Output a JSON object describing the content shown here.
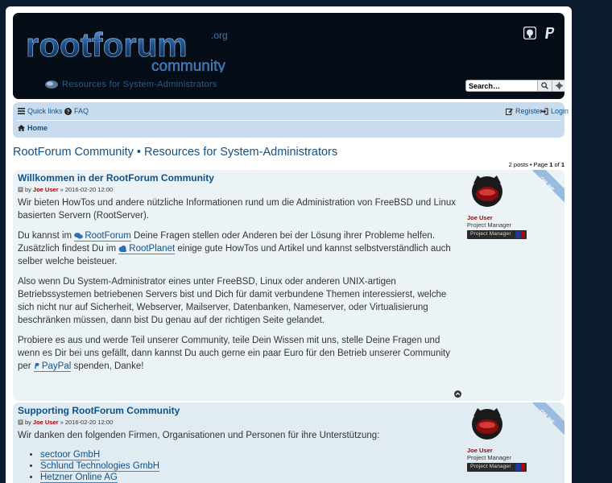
{
  "header": {
    "logo_text": "rootforum",
    "logo_org": ".org",
    "logo_sub": "community",
    "tagline": "Resources for System-Administrators",
    "search_placeholder": "Search…",
    "search_icon": "search-icon",
    "advanced_icon": "gear-icon",
    "social": [
      "github-icon",
      "paypal-icon"
    ]
  },
  "navbar": {
    "quick_links": "Quick links",
    "faq": "FAQ",
    "register": "Register",
    "login": "Login",
    "home": "Home"
  },
  "forum_title": "RootForum Community • Resources for System-Administrators",
  "pagination": {
    "prefix": "2 posts • Page ",
    "current": "1",
    "of": " of ",
    "total": "1"
  },
  "posts": [
    {
      "title": "Willkommen in der RootForum Community",
      "by": "by",
      "author": "Joe User",
      "date": "» 2016-02-20 12:00",
      "p1": "Wir bieten HowTos und andere nützliche Informationen rund um die Administration von FreeBSD und Linux basierten Servern (RootServer).",
      "p2a": "Du kannst im ",
      "p2_link1": "RootForum",
      "p2b": " Deine Fragen stellen oder Anderen bei der Lösung ihrer Probleme helfen. Zusätzlich findest Du im ",
      "p2_link2": "RootPlanet",
      "p2c": " einige gute HowTos und Artikel und kannst selbstverständlich auch selber welche beisteuer.",
      "p3": "Also wenn Du System-Administrator eines unter FreeBSD, Linux oder anderen UNIX-artigen Betriebssystemen betriebenen Servers bist und Dich für damit verbundene Themen interessierst, welche sich nicht nur auf Sicherheit, Webserver, Mailserver, Datenbanken, Nameserver, oder Virtualisierung beschränken müssen, dann bist Du genau auf der richtigen Seite gelandet.",
      "p4a": "Probiere es aus und werde Teil unserer Community, teile Dein Wissen mit uns, stelle Deine Fragen und wenn es Dir bei uns gefällt, dann kannst Du auch gerne ein paar Euro für den Betrieb unserer Community per ",
      "p4_link": "PayPal",
      "p4b": " spenden, Danke!",
      "profile_name": "Joe User",
      "profile_rank": "Project Manager",
      "rank_badge": "Project Manager",
      "online": "ONLINE"
    },
    {
      "title": "Supporting RootForum Community",
      "by": "by",
      "author": "Joe User",
      "date": "» 2016-02-20 12:00",
      "intro": "Wir danken den folgenden Firmen, Organisationen und Personen für ihre Unterstützung:",
      "sponsors": [
        "sectoor GmbH",
        "Schlund Technologies GmbH",
        "Hetzner Online AG"
      ],
      "profile_name": "Joe User",
      "profile_rank": "Project Manager",
      "rank_badge": "Project Manager",
      "online": "ONLINE"
    }
  ],
  "colors": {
    "page_bg": "#0c1b2e",
    "header_bg": "#050d17",
    "navbar_bg": "#c9dced",
    "link": "#105289",
    "username": "#aa0000",
    "post_bg1": "#ecf3f7",
    "post_bg2": "#e1ebf2"
  }
}
